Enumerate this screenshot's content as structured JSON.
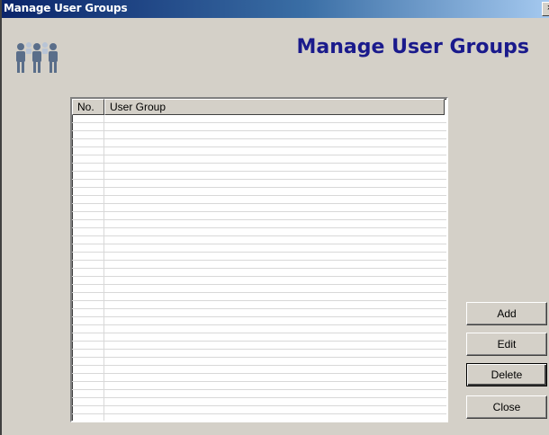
{
  "window": {
    "title": "Manage User Groups",
    "close_label": "×"
  },
  "header": {
    "title": "Manage User Groups",
    "icon": "users-group-icon"
  },
  "list": {
    "columns": [
      "No.",
      "User Group"
    ],
    "rows": []
  },
  "buttons": {
    "add": "Add",
    "edit": "Edit",
    "delete": "Delete",
    "close": "Close"
  },
  "colors": {
    "title_text": "#1a1a8c",
    "titlebar_start": "#0a246a",
    "titlebar_end": "#a6caf0",
    "face": "#d4d0c8"
  }
}
